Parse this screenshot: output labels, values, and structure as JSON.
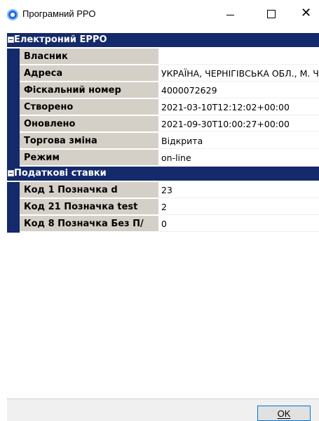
{
  "window": {
    "title": "Програмний РРО",
    "icon": "app-icon",
    "controls": {
      "minimize": "minimize-icon",
      "maximize": "maximize-icon",
      "close": "close-icon"
    }
  },
  "colors": {
    "section_bg": "#142a6a",
    "name_cell_bg": "#d4d0c8",
    "ok_border": "#0078d7"
  },
  "sections": [
    {
      "title": "Електроний ЕРРО",
      "rows": [
        {
          "name": "Власник",
          "value": ""
        },
        {
          "name": "Адреса",
          "value": "УКРАЇНА, ЧЕРНІГІВСЬКА ОБЛ., М. ЧЕ"
        },
        {
          "name": "Фіскальний номер",
          "value": "4000072629"
        },
        {
          "name": "Створено",
          "value": "2021-03-10T12:12:02+00:00"
        },
        {
          "name": "Оновлено",
          "value": "2021-09-30T10:00:27+00:00"
        },
        {
          "name": "Торгова зміна",
          "value": "Відкрита"
        },
        {
          "name": "Режим",
          "value": "on-line"
        }
      ]
    },
    {
      "title": "Податкові ставки",
      "rows": [
        {
          "name": "Код 1 Позначка d",
          "value": "23"
        },
        {
          "name": "Код 21 Позначка test",
          "value": "2"
        },
        {
          "name": "Код 8 Позначка Без П/",
          "value": "0"
        }
      ]
    }
  ],
  "footer": {
    "ok_label": "OK"
  }
}
